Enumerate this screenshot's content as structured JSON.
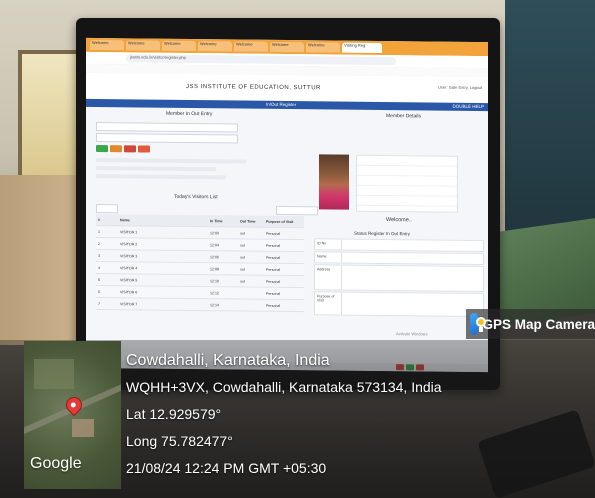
{
  "browser": {
    "tabs": [
      "Welcome",
      "Welcome",
      "Welcome",
      "Welcome",
      "Welcome",
      "Welcome",
      "Welcome",
      "Visiting Reg"
    ],
    "address": "jssstu.edu.in/visitor/register.php"
  },
  "app": {
    "title": "JSS INSTITUTE OF EDUCATION, SUTTUR",
    "user": "User: Gate Entry, Logout",
    "nav_center": "In/Out Register",
    "nav_right": "DOUBLE HELP"
  },
  "left_panel": {
    "entry_title": "Member In Out Entry",
    "table_title": "Today's Visitors List",
    "columns": [
      "#",
      "Name",
      "In Time",
      "Out Time",
      "Purpose of Visit"
    ],
    "rows": [
      {
        "id": "1",
        "name": "VISITOR 1",
        "in": "12:00",
        "out": "out",
        "purpose": "Personal"
      },
      {
        "id": "2",
        "name": "VISITOR 2",
        "in": "12:04",
        "out": "out",
        "purpose": "Personal"
      },
      {
        "id": "3",
        "name": "VISITOR 3",
        "in": "12:06",
        "out": "out",
        "purpose": "Personal"
      },
      {
        "id": "4",
        "name": "VISITOR 4",
        "in": "12:08",
        "out": "out",
        "purpose": "Personal"
      },
      {
        "id": "5",
        "name": "VISITOR 5",
        "in": "12:10",
        "out": "out",
        "purpose": "Personal"
      },
      {
        "id": "6",
        "name": "VISITOR 6",
        "in": "12:12",
        "out": "",
        "purpose": "Personal"
      },
      {
        "id": "7",
        "name": "VISITOR 7",
        "in": "12:14",
        "out": "",
        "purpose": "Personal"
      }
    ]
  },
  "right_panel": {
    "details_title": "Member Details",
    "welcome": "Welcome..",
    "status_title": "Status Register In Out Entry",
    "form_labels": [
      "ID No",
      "Name",
      "Address",
      "Purpose of Visit"
    ],
    "activate": "Activate Windows"
  },
  "overlay": {
    "badge": "GPS Map Camera",
    "place": "Cowdahalli, Karnataka, India",
    "address": "WQHH+3VX, Cowdahalli, Karnataka 573134, India",
    "lat": "Lat 12.929579°",
    "long": "Long 75.782477°",
    "timestamp": "21/08/24 12:24 PM GMT +05:30",
    "map_brand": "Google"
  }
}
